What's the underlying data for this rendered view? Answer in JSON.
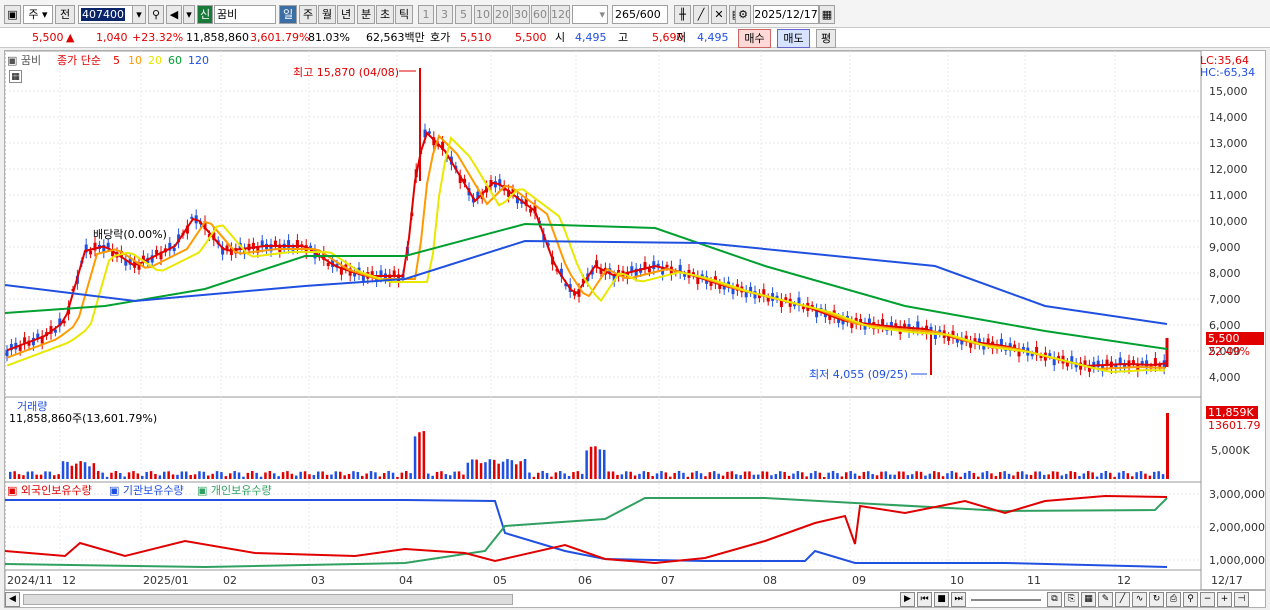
{
  "toolbar": {
    "market": "주",
    "prev": "전",
    "code": "407400",
    "sel_mark": "신",
    "name": "꿈비",
    "periods": [
      "일",
      "주",
      "월",
      "년",
      "분",
      "초",
      "틱"
    ],
    "intervals": [
      "1",
      "3",
      "5",
      "10",
      "20",
      "30",
      "60",
      "120"
    ],
    "count": "265",
    "count_total": "/600",
    "date": "2025/12/17"
  },
  "quote": {
    "price": "5,500",
    "up_arrow": "▲",
    "change": "1,040",
    "change_pct": "+23.32%",
    "volume": "11,858,860",
    "vol_pct": "3,601.79%",
    "ratio": "81.03%",
    "amount": "62,563백만",
    "hoga_lbl": "호가",
    "hoga1": "5,510",
    "hoga2": "5,500",
    "open_lbl": "시",
    "open": "4,495",
    "high_lbl": "고",
    "high": "5,690",
    "low_lbl": "저",
    "low": "4,495",
    "buy": "매수",
    "sell": "매도",
    "eval": "평"
  },
  "chart": {
    "name": "꿈비",
    "ma_title": "종가 단순",
    "ma": [
      {
        "p": "5",
        "c": "#e00000"
      },
      {
        "p": "10",
        "c": "#ff9a00"
      },
      {
        "p": "20",
        "c": "#e8e800"
      },
      {
        "p": "60",
        "c": "#00a030"
      },
      {
        "p": "120",
        "c": "#2050e0"
      }
    ],
    "lc": "LC:35,64",
    "hc": "HC:-65,34",
    "high_note": "최고 15,870 (04/08)",
    "low_note": "최저 4,055 (09/25)",
    "div_note": "배당락(0.00%)",
    "y_ticks": [
      "15,000",
      "14,000",
      "13,000",
      "12,000",
      "11,000",
      "10,000",
      "9,000",
      "8,000",
      "7,000",
      "6,000",
      "5,000",
      "4,000"
    ],
    "cur_price": "5,500",
    "cur_pct": "22.49%",
    "vol_title": "거래량",
    "vol_info": "11,858,860주(13,601.79%)",
    "vol_tag": "11,859K",
    "vol_pct": "13601.79",
    "vol_tick": "5,000K",
    "hold_labels": [
      "외국인보유수량",
      "기관보유수량",
      "개인보유수량"
    ],
    "hold_ticks": [
      "3,000,000",
      "2,000,000",
      "1,000,000"
    ],
    "x_labels": [
      "2024/11",
      "12",
      "2025/01",
      "02",
      "03",
      "04",
      "05",
      "06",
      "07",
      "08",
      "09",
      "10",
      "11",
      "12"
    ],
    "x_right": "12/17"
  },
  "colors": {
    "up": "#e00000",
    "down": "#2050e0",
    "ma5": "#e00000",
    "ma10": "#ff9a00",
    "ma20": "#e8e800",
    "ma60": "#00a030",
    "ma120": "#2050e0",
    "foreign": "#e00000",
    "inst": "#2050e0",
    "indiv": "#30a060"
  }
}
